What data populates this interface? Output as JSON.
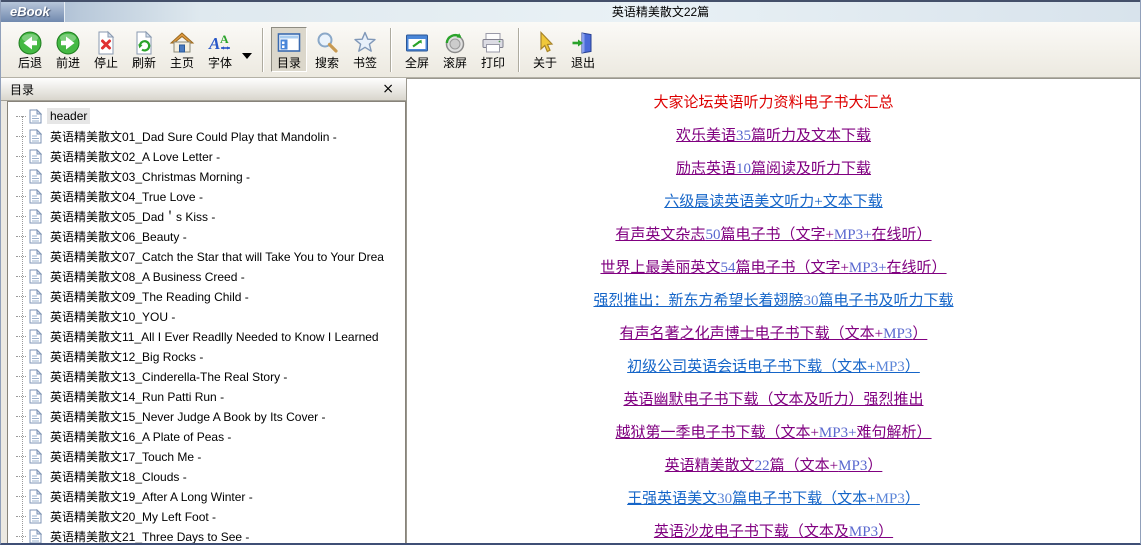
{
  "window": {
    "logo": "eBook",
    "title": "英语精美散文22篇"
  },
  "toolbar": {
    "buttons": [
      {
        "label": "后退",
        "icon": "back",
        "group": 0,
        "pressed": false
      },
      {
        "label": "前进",
        "icon": "forward",
        "group": 0,
        "pressed": false
      },
      {
        "label": "停止",
        "icon": "stop",
        "group": 0,
        "pressed": false
      },
      {
        "label": "刷新",
        "icon": "refresh",
        "group": 0,
        "pressed": false
      },
      {
        "label": "主页",
        "icon": "home",
        "group": 0,
        "pressed": false
      },
      {
        "label": "字体",
        "icon": "font",
        "group": 0,
        "pressed": false,
        "has_dropdown": true
      },
      {
        "label": "目录",
        "icon": "toc",
        "group": 1,
        "pressed": true
      },
      {
        "label": "搜索",
        "icon": "search",
        "group": 1,
        "pressed": false
      },
      {
        "label": "书签",
        "icon": "bookmark",
        "group": 1,
        "pressed": false
      },
      {
        "label": "全屏",
        "icon": "fullscreen",
        "group": 2,
        "pressed": false
      },
      {
        "label": "滚屏",
        "icon": "scroll",
        "group": 2,
        "pressed": false
      },
      {
        "label": "打印",
        "icon": "print",
        "group": 2,
        "pressed": false
      },
      {
        "label": "关于",
        "icon": "about",
        "group": 3,
        "pressed": false
      },
      {
        "label": "退出",
        "icon": "exit",
        "group": 3,
        "pressed": false
      }
    ]
  },
  "sidebar": {
    "title": "目录",
    "close_glyph": "×",
    "items": [
      {
        "label": "header",
        "selected": true
      },
      {
        "label": "英语精美散文01_Dad Sure Could Play that Mandolin -"
      },
      {
        "label": "英语精美散文02_A Love Letter -"
      },
      {
        "label": "英语精美散文03_Christmas Morning -"
      },
      {
        "label": "英语精美散文04_True Love -"
      },
      {
        "label": "英语精美散文05_Dad＇s Kiss -"
      },
      {
        "label": "英语精美散文06_Beauty -"
      },
      {
        "label": "英语精美散文07_Catch the Star that will Take You to Your Drea"
      },
      {
        "label": "英语精美散文08_A Business Creed -"
      },
      {
        "label": "英语精美散文09_The Reading Child -"
      },
      {
        "label": "英语精美散文10_YOU -"
      },
      {
        "label": "英语精美散文11_All I Ever Readlly Needed to Know I Learned"
      },
      {
        "label": "英语精美散文12_Big Rocks -"
      },
      {
        "label": "英语精美散文13_Cinderella-The Real Story -"
      },
      {
        "label": "英语精美散文14_Run Patti Run -"
      },
      {
        "label": "英语精美散文15_Never Judge A Book by Its Cover -"
      },
      {
        "label": "英语精美散文16_A Plate of Peas -"
      },
      {
        "label": "英语精美散文17_Touch Me -"
      },
      {
        "label": "英语精美散文18_Clouds -"
      },
      {
        "label": "英语精美散文19_After A Long Winter -"
      },
      {
        "label": "英语精美散文20_My Left Foot -"
      },
      {
        "label": "英语精美散文21_Three Days to See -"
      }
    ]
  },
  "content": {
    "rows": [
      {
        "text": "大家论坛英语听力资料电子书大汇总",
        "style": "red-heading"
      },
      {
        "text": "欢乐美语35篇听力及文本下载",
        "style": "purple"
      },
      {
        "text": "励志英语10篇阅读及听力下载",
        "style": "purple"
      },
      {
        "text": "六级晨读英语美文听力+文本下载",
        "style": "blue"
      },
      {
        "text": "有声英文杂志50篇电子书（文字+MP3+在线听）",
        "style": "purple"
      },
      {
        "text": "世界上最美丽英文54篇电子书（文字+MP3+在线听）",
        "style": "purple"
      },
      {
        "text": "强烈推出：新东方希望长着翅膀30篇电子书及听力下载",
        "style": "blue"
      },
      {
        "text": "有声名著之化声博士电子书下载（文本+MP3）",
        "style": "purple"
      },
      {
        "text": "初级公司英语会话电子书下载（文本+MP3）",
        "style": "blue"
      },
      {
        "text": "英语幽默电子书下载（文本及听力）强烈推出",
        "style": "purple"
      },
      {
        "text": "越狱第一季电子书下载（文本+MP3+难句解析）",
        "style": "purple"
      },
      {
        "text": "英语精美散文22篇（文本+MP3）",
        "style": "purple"
      },
      {
        "text": "王强英语美文30篇电子书下载（文本+MP3）",
        "style": "blue"
      },
      {
        "text": "英语沙龙电子书下载（文本及MP3）",
        "style": "purple"
      }
    ]
  },
  "colors": {
    "heading_red": "#dd0000",
    "link_purple": "#800080",
    "link_blue": "#1565c8",
    "titlebar_left": "#93a8c8",
    "pressed_button_bg": "#dbd7cb"
  }
}
